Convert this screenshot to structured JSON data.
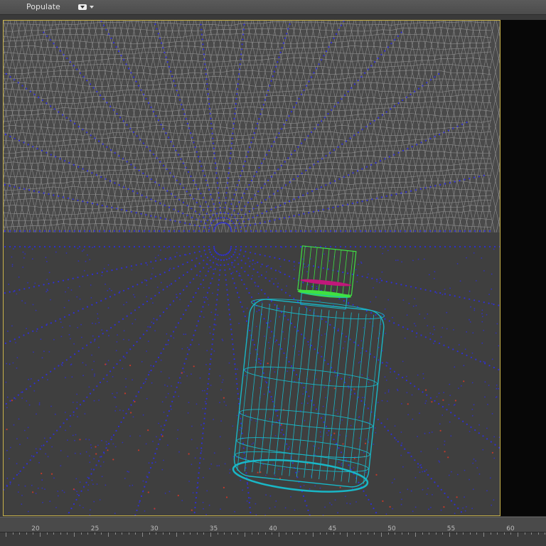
{
  "toolbar": {
    "menu_label": "Populate",
    "dropdown_icon": "dropdown-toggle-icon"
  },
  "viewport": {
    "description_free": true,
    "colors": {
      "frame_border": "#c8b24a",
      "mesh_top": "#9a9a9a",
      "vertex_dots": "#2f2fd6",
      "bottle_body": "#19b7c6",
      "bottle_cap": "#3fe042",
      "cap_band": "#c0187a",
      "accent_points": "#c23a2a"
    }
  },
  "timeline": {
    "ticks": [
      "20",
      "25",
      "30",
      "35",
      "40",
      "45",
      "50",
      "55",
      "60"
    ]
  }
}
